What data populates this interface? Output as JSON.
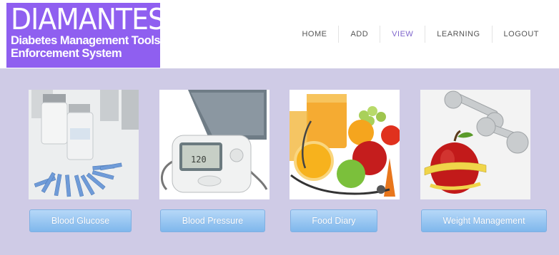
{
  "logo": {
    "title": "DIAMANTES",
    "subtitle_line1": "Diabetes Management Tools",
    "subtitle_line2": "Enforcement System"
  },
  "nav": {
    "items": [
      {
        "label": "HOME"
      },
      {
        "label": "ADD"
      },
      {
        "label": "VIEW"
      },
      {
        "label": "LEARNING"
      },
      {
        "label": "LOGOUT"
      }
    ],
    "active": "VIEW"
  },
  "tiles": [
    {
      "label": "Blood Glucose",
      "image": "glucose-test-strips-image"
    },
    {
      "label": "Blood Pressure",
      "image": "blood-pressure-monitor-image"
    },
    {
      "label": "Food Diary",
      "image": "fruit-and-juice-image"
    },
    {
      "label": "Weight Management",
      "image": "apple-with-tape-and-dumbbells-image"
    }
  ],
  "colors": {
    "logo_bg": "#8f5ff0",
    "content_bg": "#cfcbe6",
    "button_gradient_top": "#b6d8f8",
    "button_gradient_bottom": "#7fb7ec",
    "nav_active": "#7f66cc"
  }
}
